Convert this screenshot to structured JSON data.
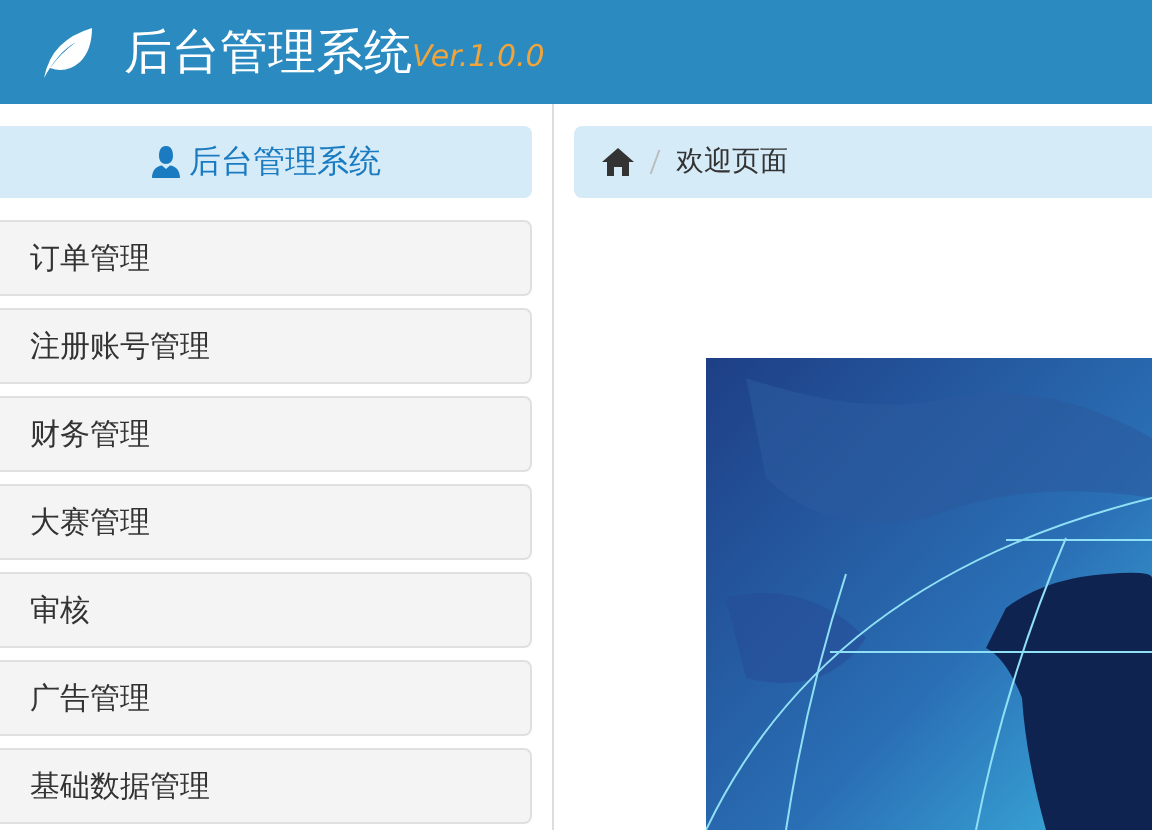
{
  "header": {
    "title": "后台管理系统",
    "version": "Ver.1.0.0"
  },
  "sidebar": {
    "title": "后台管理系统",
    "items": [
      {
        "label": "订单管理"
      },
      {
        "label": "注册账号管理"
      },
      {
        "label": "财务管理"
      },
      {
        "label": "大赛管理"
      },
      {
        "label": "审核"
      },
      {
        "label": "广告管理"
      },
      {
        "label": "基础数据管理"
      }
    ]
  },
  "breadcrumb": {
    "current": "欢迎页面"
  }
}
